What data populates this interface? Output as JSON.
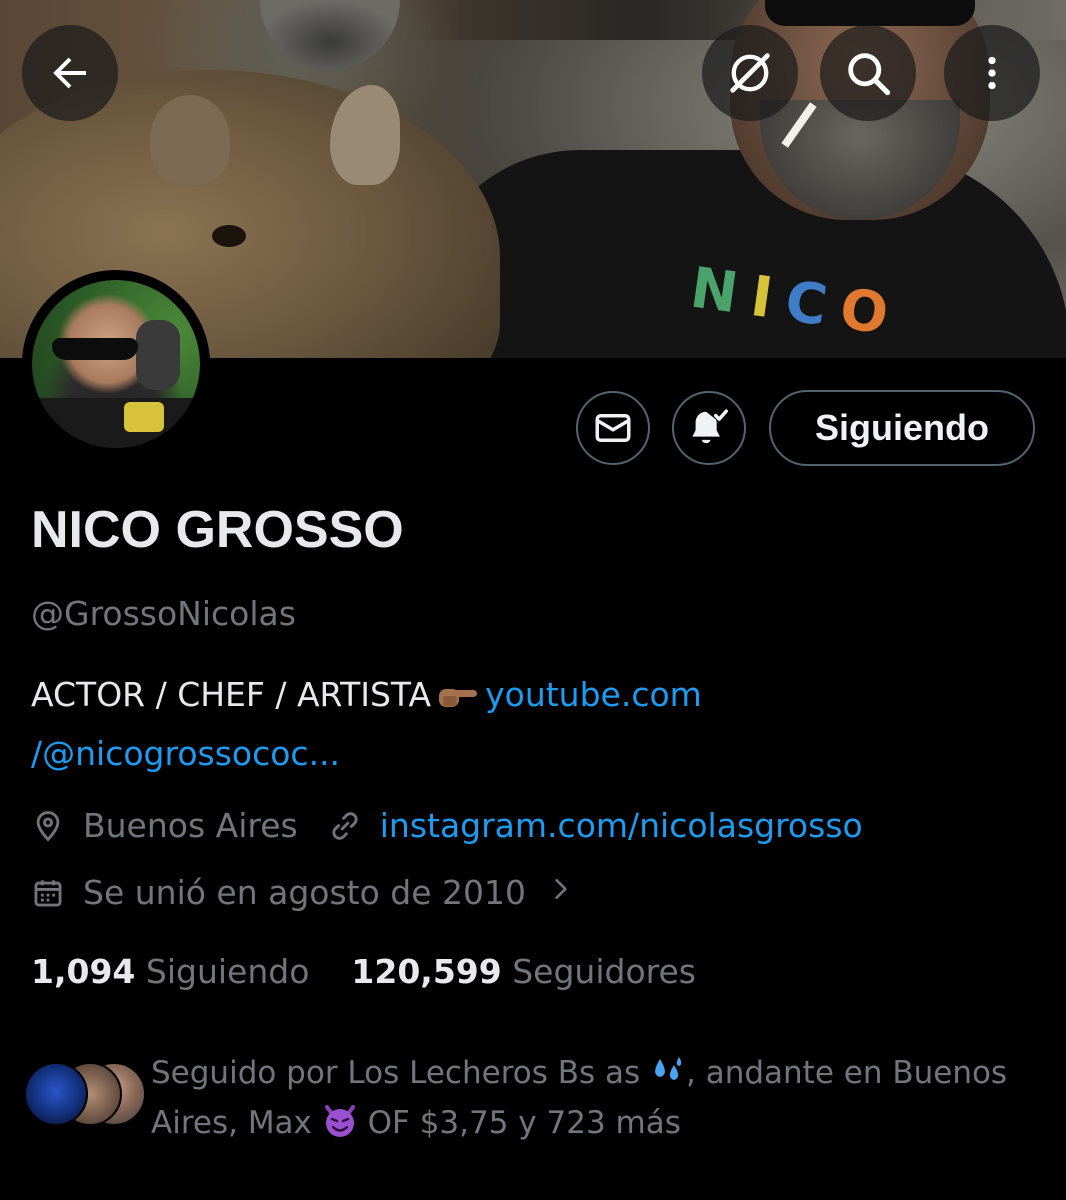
{
  "profile": {
    "name": "NICO GROSSO",
    "handle": "@GrossoNicolas",
    "bio_text": "ACTOR / CHEF / ARTISTA",
    "bio_link_line1": "youtube.com",
    "bio_link_line2": "/@nicogrossococ...",
    "location": "Buenos Aires",
    "website": "instagram.com/nicolasgrosso",
    "joined": "Se unió en agosto de 2010"
  },
  "actions": {
    "follow_state_label": "Siguiendo"
  },
  "stats": {
    "following_count": "1,094",
    "following_label": "Siguiendo",
    "followers_count": "120,599",
    "followers_label": "Seguidores"
  },
  "followed_by": {
    "text_part1": "Seguido por Los Lecheros Bs as ",
    "text_part2": ", andante en Buenos Aires, Max ",
    "text_part3": " OF $3,75 y 723 más"
  },
  "banner": {
    "shirt_letters": [
      "N",
      "I",
      "C",
      "O"
    ]
  },
  "colors": {
    "background": "#000000",
    "accent_link": "#1d9bf0",
    "secondary_text": "#71767b",
    "primary_text": "#e7e9ea",
    "button_border": "#536471"
  },
  "icons": {
    "back": "arrow-left-icon",
    "hide_media": "no-image-icon",
    "search": "search-icon",
    "more": "more-vertical-icon",
    "message": "envelope-icon",
    "notifications": "bell-check-icon",
    "location": "location-pin-icon",
    "website": "link-icon",
    "joined": "calendar-icon",
    "chevron": "chevron-right-icon"
  }
}
